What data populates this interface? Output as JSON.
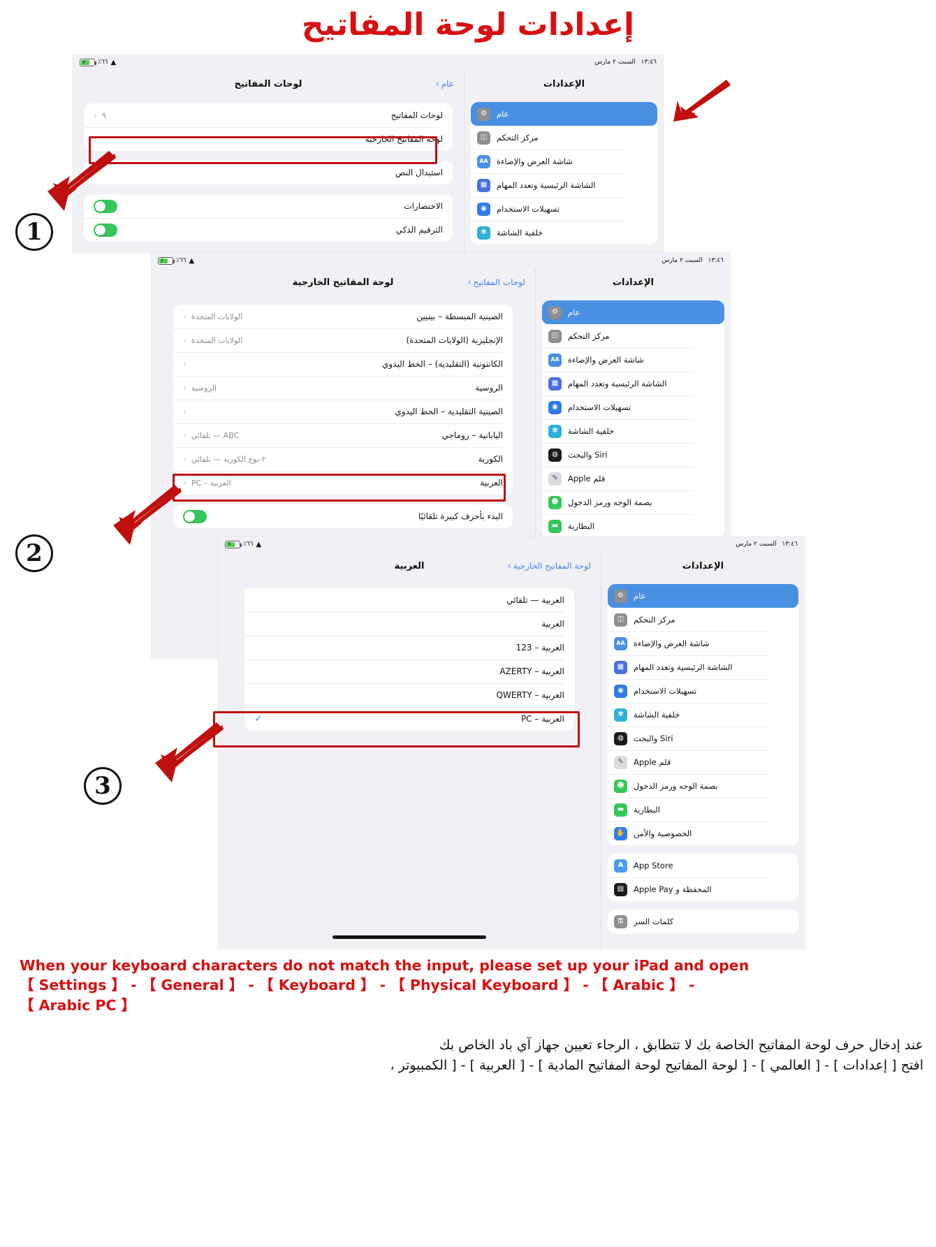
{
  "page": {
    "title": "إعدادات لوحة المفاتيح"
  },
  "status_bar": {
    "battery_percent": "٪٦٦",
    "time": "١٣:٤٦",
    "date": "السبت ٢ مارس"
  },
  "steps": {
    "one": "1",
    "two": "2",
    "three": "3"
  },
  "panel1": {
    "nav": {
      "back_label": "عام",
      "title": "لوحات المفاتيح"
    },
    "rows": [
      {
        "label": "لوحات المفاتيح",
        "value": "٩"
      },
      {
        "label": "لوحة المفاتيح الخارجية",
        "value": ""
      },
      {
        "label": "استبدال النص",
        "value": ""
      }
    ],
    "toggles": [
      {
        "label": "الاختصارات"
      },
      {
        "label": "الترقيم الذكي"
      }
    ],
    "settings": {
      "title": "الإعدادات",
      "items": [
        {
          "label": "عام",
          "icon": "gear-icon",
          "color": "#8e8e93",
          "glyph": "⚙",
          "selected": true
        },
        {
          "label": "مركز التحكم",
          "icon": "control-center-icon",
          "color": "#8e8e93",
          "glyph": "◫",
          "selected": false
        },
        {
          "label": "شاشة العرض والإضاءة",
          "icon": "display-brightness-icon",
          "color": "#4a90e2",
          "glyph": "AA",
          "selected": false
        },
        {
          "label": "الشاشة الرئيسية وتعدد المهام",
          "icon": "home-screen-icon",
          "color": "#4a6fe0",
          "glyph": "▦",
          "selected": false
        },
        {
          "label": "تسهيلات الاستخدام",
          "icon": "accessibility-icon",
          "color": "#2f7bea",
          "glyph": "◉",
          "selected": false
        },
        {
          "label": "خلفية الشاشة",
          "icon": "wallpaper-icon",
          "color": "#2eb0d8",
          "glyph": "✾",
          "selected": false
        }
      ]
    }
  },
  "panel2": {
    "nav": {
      "back_label": "لوحات المفاتيح",
      "title": "لوحة المفاتيح الخارجية"
    },
    "rows": [
      {
        "label": "الصينية المبسطة – بينيين",
        "value": "الولايات المتحدة"
      },
      {
        "label": "الإنجليزية (الولايات المتحدة)",
        "value": "الولايات المتحدة"
      },
      {
        "label": "الكانتونية (التقليدية) – الخط اليدوي",
        "value": ""
      },
      {
        "label": "الروسية",
        "value": "الروسية"
      },
      {
        "label": "الصينية التقليدية – الخط اليدوي",
        "value": ""
      },
      {
        "label": "اليابانية – روماجي",
        "value": "ABC — تلقائي"
      },
      {
        "label": "الكورية",
        "value": "٢-نوع الكورية — تلقائي"
      },
      {
        "label": "العربية",
        "value": "العربية – PC"
      }
    ],
    "toggles": [
      {
        "label": "البدء بأحرف كبيرة تلقائيًا"
      }
    ],
    "settings": {
      "title": "الإعدادات",
      "items": [
        {
          "label": "عام",
          "icon": "gear-icon",
          "color": "#8e8e93",
          "glyph": "⚙",
          "selected": true
        },
        {
          "label": "مركز التحكم",
          "icon": "control-center-icon",
          "color": "#8e8e93",
          "glyph": "◫",
          "selected": false
        },
        {
          "label": "شاشة العرض والإضاءة",
          "icon": "display-brightness-icon",
          "color": "#4a90e2",
          "glyph": "AA",
          "selected": false
        },
        {
          "label": "الشاشة الرئيسية وتعدد المهام",
          "icon": "home-screen-icon",
          "color": "#4a6fe0",
          "glyph": "▦",
          "selected": false
        },
        {
          "label": "تسهيلات الاستخدام",
          "icon": "accessibility-icon",
          "color": "#2f7bea",
          "glyph": "◉",
          "selected": false
        },
        {
          "label": "خلفية الشاشة",
          "icon": "wallpaper-icon",
          "color": "#2eb0d8",
          "glyph": "✾",
          "selected": false
        },
        {
          "label": "Siri والبحث",
          "icon": "siri-icon",
          "color": "#1c1c1e",
          "glyph": "◍",
          "selected": false
        },
        {
          "label": "قلم Apple",
          "icon": "apple-pencil-icon",
          "color": "#d9d9de",
          "glyph": "✎",
          "selected": false
        },
        {
          "label": "بصمة الوجه ورمز الدخول",
          "icon": "face-id-icon",
          "color": "#34c759",
          "glyph": "☻",
          "selected": false
        },
        {
          "label": "البطارية",
          "icon": "battery-icon",
          "color": "#34c759",
          "glyph": "▬",
          "selected": false
        }
      ]
    }
  },
  "panel3": {
    "nav": {
      "back_label": "لوحة المفاتيح الخارجية",
      "title": "العربية"
    },
    "options": [
      {
        "label": "العربية — تلقائي",
        "checked": false
      },
      {
        "label": "العربية",
        "checked": false
      },
      {
        "label": "العربية – 123",
        "checked": false
      },
      {
        "label": "العربية – AZERTY",
        "checked": false
      },
      {
        "label": "العربية – QWERTY",
        "checked": false
      },
      {
        "label": "العربية – PC",
        "checked": true
      }
    ],
    "check_glyph": "✓",
    "settings": {
      "title": "الإعدادات",
      "items": [
        {
          "label": "عام",
          "icon": "gear-icon",
          "color": "#8e8e93",
          "glyph": "⚙",
          "selected": true
        },
        {
          "label": "مركز التحكم",
          "icon": "control-center-icon",
          "color": "#8e8e93",
          "glyph": "◫",
          "selected": false
        },
        {
          "label": "شاشة العرض والإضاءة",
          "icon": "display-brightness-icon",
          "color": "#4a90e2",
          "glyph": "AA",
          "selected": false
        },
        {
          "label": "الشاشة الرئيسية وتعدد المهام",
          "icon": "home-screen-icon",
          "color": "#4a6fe0",
          "glyph": "▦",
          "selected": false
        },
        {
          "label": "تسهيلات الاستخدام",
          "icon": "accessibility-icon",
          "color": "#2f7bea",
          "glyph": "◉",
          "selected": false
        },
        {
          "label": "خلفية الشاشة",
          "icon": "wallpaper-icon",
          "color": "#2eb0d8",
          "glyph": "✾",
          "selected": false
        },
        {
          "label": "Siri والبحث",
          "icon": "siri-icon",
          "color": "#1c1c1e",
          "glyph": "◍",
          "selected": false
        },
        {
          "label": "قلم Apple",
          "icon": "apple-pencil-icon",
          "color": "#d9d9de",
          "glyph": "✎",
          "selected": false
        },
        {
          "label": "بصمة الوجه ورمز الدخول",
          "icon": "face-id-icon",
          "color": "#34c759",
          "glyph": "☻",
          "selected": false
        },
        {
          "label": "البطارية",
          "icon": "battery-icon",
          "color": "#34c759",
          "glyph": "▬",
          "selected": false
        },
        {
          "label": "الخصوصية والأمن",
          "icon": "privacy-icon",
          "color": "#2f7bea",
          "glyph": "✋",
          "selected": false
        }
      ],
      "items2": [
        {
          "label": "App Store",
          "icon": "app-store-icon",
          "color": "#4a9cf0",
          "glyph": "A",
          "selected": false
        },
        {
          "label": "المحفظة و Apple Pay",
          "icon": "wallet-icon",
          "color": "#1c1c1e",
          "glyph": "▤",
          "selected": false
        }
      ],
      "items3": [
        {
          "label": "كلمات السر",
          "icon": "passwords-icon",
          "color": "#8e8e93",
          "glyph": "🔑",
          "selected": false
        }
      ]
    }
  },
  "footer": {
    "english_line1": "When your keyboard characters do not match the input, please set up your iPad and open",
    "english_line2": "【 Settings 】 -  【 General 】 -  【 Keyboard 】 -  【 Physical Keyboard 】 -  【 Arabic 】 -",
    "english_line3": "【 Arabic PC 】",
    "arabic_line1": "عند إدخال حرف لوحة المفاتيح الخاصة بك لا تتطابق ، الرجاء تعيين جهاز آي باد الخاص بك",
    "arabic_line2": "افتح [ إعدادات ] - [ العالمي ] - [ لوحة المفاتيح لوحة المفاتيح المادية ] - [ العربية ] - [ الكمبيوتر ،"
  }
}
